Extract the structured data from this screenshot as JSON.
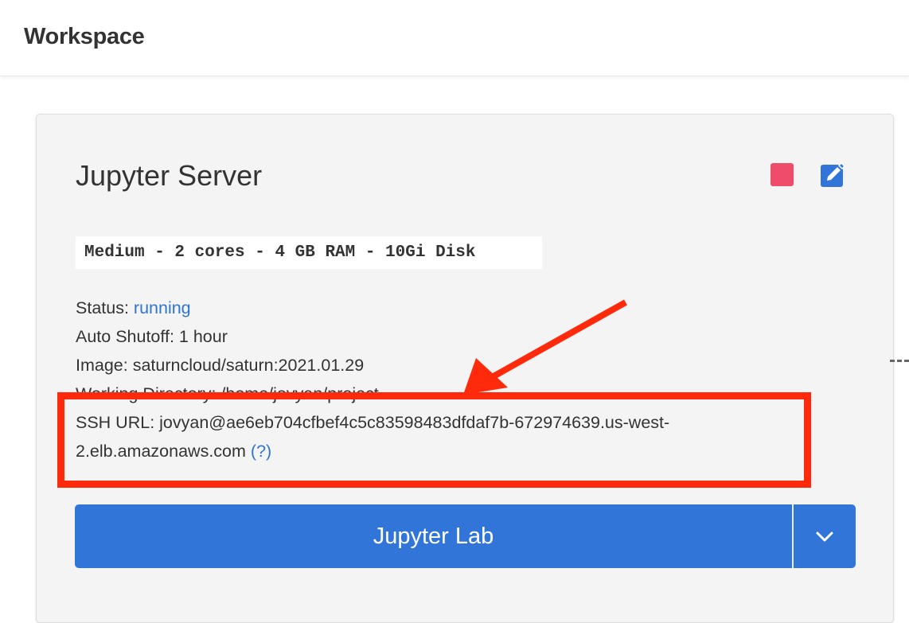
{
  "header": {
    "title": "Workspace"
  },
  "server_card": {
    "title": "Jupyter Server",
    "size": "Medium - 2 cores - 4 GB RAM - 10Gi Disk",
    "status_label": "Status:",
    "status_value": "running",
    "auto_shutoff": "Auto Shutoff: 1 hour",
    "image": "Image: saturncloud/saturn:2021.01.29",
    "working_directory": "Working Directory: /home/jovyan/project",
    "ssh_url_line1": "SSH URL: jovyan@ae6eb704cfbef4c5c83598483dfdaf7b-672974639.us-west-",
    "ssh_url_line2": "2.elb.amazonaws.com",
    "ssh_help": "(?)",
    "launch_button": "Jupyter Lab",
    "stop_icon": "stop-square-icon",
    "edit_icon": "edit-pencil-icon",
    "dropdown_icon": "chevron-down-icon"
  },
  "colors": {
    "primary": "#3275d8",
    "stop": "#ef4b6a",
    "link": "#2f74d0",
    "annotation": "#ff2a0c"
  }
}
